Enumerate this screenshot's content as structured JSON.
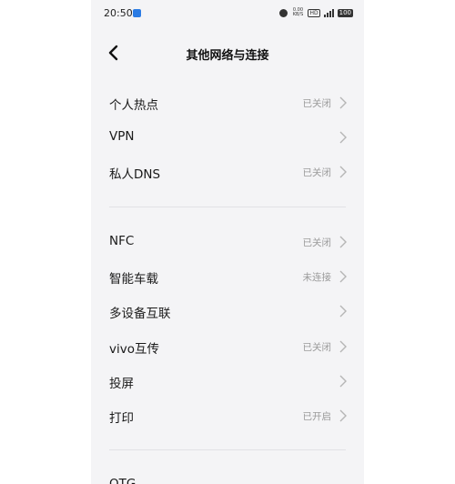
{
  "status_bar": {
    "time": "20:50",
    "speed_top": "0.00",
    "speed_bottom": "KB/S",
    "hd": "HD",
    "battery": "100"
  },
  "header": {
    "title": "其他网络与连接"
  },
  "sections": [
    {
      "items": [
        {
          "label": "个人热点",
          "value": "已关闭"
        },
        {
          "label": "VPN",
          "value": ""
        },
        {
          "label": "私人DNS",
          "value": "已关闭"
        }
      ]
    },
    {
      "items": [
        {
          "label": "NFC",
          "value": "已关闭"
        },
        {
          "label": "智能车载",
          "value": "未连接"
        },
        {
          "label": "多设备互联",
          "value": ""
        },
        {
          "label": "vivo互传",
          "value": "已关闭"
        },
        {
          "label": "投屏",
          "value": ""
        },
        {
          "label": "打印",
          "value": "已开启"
        }
      ]
    },
    {
      "items": [
        {
          "label": "OTG",
          "value": ""
        }
      ]
    }
  ]
}
